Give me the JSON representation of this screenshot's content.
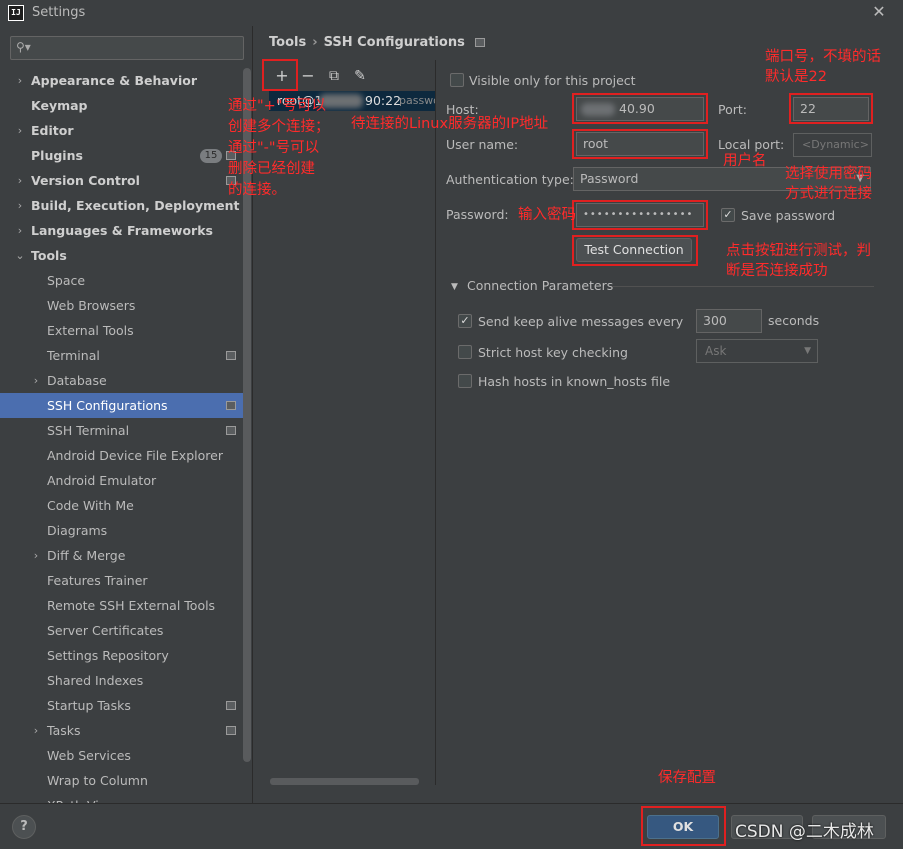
{
  "window": {
    "title": "Settings",
    "close": "✕"
  },
  "search": {
    "placeholder": ""
  },
  "sidebar": {
    "items": [
      {
        "label": "Appearance & Behavior"
      },
      {
        "label": "Keymap"
      },
      {
        "label": "Editor"
      },
      {
        "label": "Plugins",
        "badge": "15"
      },
      {
        "label": "Version Control"
      },
      {
        "label": "Build, Execution, Deployment"
      },
      {
        "label": "Languages & Frameworks"
      },
      {
        "label": "Tools"
      },
      {
        "label": "Space"
      },
      {
        "label": "Web Browsers"
      },
      {
        "label": "External Tools"
      },
      {
        "label": "Terminal"
      },
      {
        "label": "Database"
      },
      {
        "label": "SSH Configurations"
      },
      {
        "label": "SSH Terminal"
      },
      {
        "label": "Android Device File Explorer"
      },
      {
        "label": "Android Emulator"
      },
      {
        "label": "Code With Me"
      },
      {
        "label": "Diagrams"
      },
      {
        "label": "Diff & Merge"
      },
      {
        "label": "Features Trainer"
      },
      {
        "label": "Remote SSH External Tools"
      },
      {
        "label": "Server Certificates"
      },
      {
        "label": "Settings Repository"
      },
      {
        "label": "Shared Indexes"
      },
      {
        "label": "Startup Tasks"
      },
      {
        "label": "Tasks"
      },
      {
        "label": "Web Services"
      },
      {
        "label": "Wrap to Column"
      },
      {
        "label": "XPath Viewer"
      }
    ]
  },
  "breadcrumb": {
    "root": "Tools",
    "sep": "›",
    "current": "SSH Configurations"
  },
  "toolbar": {
    "add": "+",
    "remove": "−",
    "copy": "⧉",
    "edit": "✎"
  },
  "configs": [
    {
      "label_prefix": "root@1",
      "label_suffix": "90:22",
      "auth": "passwo"
    }
  ],
  "form": {
    "visible_only_label": "Visible only for this project",
    "host_label": "Host:",
    "host_value": "40.90",
    "port_label": "Port:",
    "port_value": "22",
    "user_label": "User name:",
    "user_value": "root",
    "local_port_label": "Local port:",
    "local_port_value": "<Dynamic>",
    "auth_type_label": "Authentication type:",
    "auth_type_value": "Password",
    "password_label": "Password:",
    "password_value": "••••••••••••••••",
    "save_password_label": "Save password",
    "test_connection_label": "Test Connection"
  },
  "connection_params": {
    "title": "Connection Parameters",
    "keep_alive_label": "Send keep alive messages every",
    "keep_alive_value": "300",
    "seconds_label": "seconds",
    "strict_host_label": "Strict host key checking",
    "strict_host_value": "Ask",
    "hash_hosts_label": "Hash hosts in known_hosts file"
  },
  "footer": {
    "help": "?",
    "ok": "OK"
  },
  "annotations": {
    "port_note_1": "端口号，不填的话",
    "port_note_2": "默认是22",
    "add_note_1": "通过\"+\"号可以",
    "add_note_2": "创建多个连接；",
    "add_note_3": "通过\"-\"号可以",
    "add_note_4": "删除已经创建",
    "add_note_5": "的连接。",
    "host_note": "待连接的Linux服务器的IP地址",
    "user_note": "用户名",
    "auth_note_1": "选择使用密码",
    "auth_note_2": "方式进行连接",
    "password_note": "输入密码",
    "test_note_1": "点击按钮进行测试，判",
    "test_note_2": "断是否连接成功",
    "save_note": "保存配置"
  },
  "watermark": "CSDN @二木成林",
  "colors": {
    "annotation": "#e02020",
    "selection": "#4b6eaf",
    "ok_button": "#365880"
  }
}
